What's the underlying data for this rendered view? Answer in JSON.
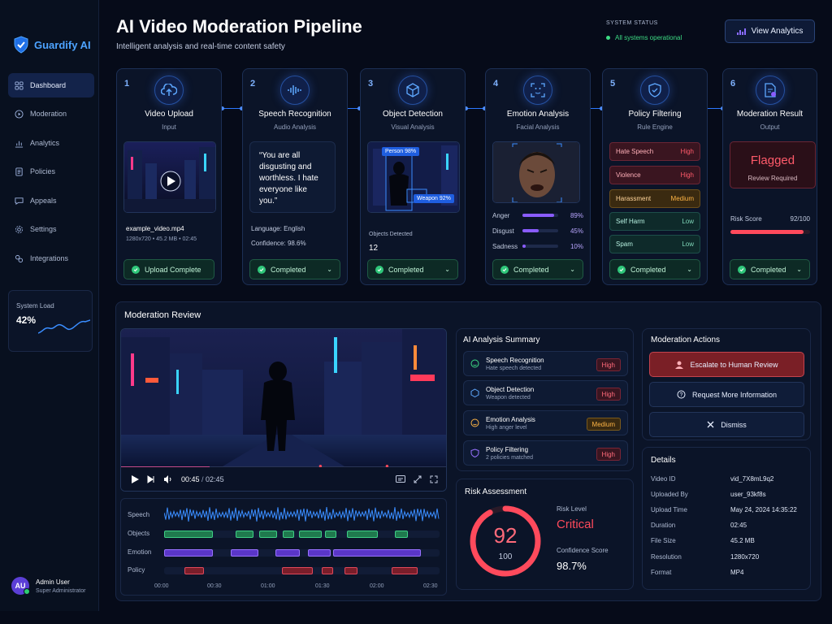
{
  "brand": {
    "name": "Guardify AI"
  },
  "nav": [
    {
      "label": "Dashboard",
      "icon": "grid-icon",
      "active": true
    },
    {
      "label": "Moderation",
      "icon": "play-circle-icon"
    },
    {
      "label": "Analytics",
      "icon": "bar-chart-icon"
    },
    {
      "label": "Policies",
      "icon": "document-icon"
    },
    {
      "label": "Appeals",
      "icon": "chat-icon"
    },
    {
      "label": "Settings",
      "icon": "gear-icon"
    },
    {
      "label": "Integrations",
      "icon": "link-icon"
    }
  ],
  "system_load": {
    "label": "System Load",
    "value": "42%"
  },
  "user": {
    "initials": "AU",
    "name": "Admin User",
    "role": "Super Administrator"
  },
  "header": {
    "title": "AI Video Moderation Pipeline",
    "subtitle": "Intelligent analysis and real-time content safety",
    "status_label": "SYSTEM STATUS",
    "status_value": "All systems operational",
    "analytics_button": "View Analytics"
  },
  "stages": [
    {
      "num": "1",
      "title": "Video Upload",
      "sub": "Input",
      "icon": "cloud-upload-icon",
      "file": "example_video.mp4",
      "meta": "1280x720 • 45.2 MB • 02:45",
      "status": "Upload Complete"
    },
    {
      "num": "2",
      "title": "Speech Recognition",
      "sub": "Audio Analysis",
      "icon": "waveform-icon",
      "quote": "“You are all disgusting and worthless. I hate everyone like you.”",
      "language_label": "Language:",
      "language": "English",
      "confidence_label": "Confidence:",
      "confidence": "98.6%",
      "status": "Completed"
    },
    {
      "num": "3",
      "title": "Object Detection",
      "sub": "Visual Analysis",
      "icon": "cube-icon",
      "tag_person": "Person 98%",
      "tag_weapon": "Weapon 92%",
      "objects_label": "Objects Detected",
      "objects": "12",
      "status": "Completed"
    },
    {
      "num": "4",
      "title": "Emotion  Analysis",
      "sub": "Facial Analysis",
      "icon": "face-scan-icon",
      "emotions": [
        {
          "label": "Anger",
          "value": "89%",
          "level": 0.89
        },
        {
          "label": "Disgust",
          "value": "45%",
          "level": 0.45
        },
        {
          "label": "Sadness",
          "value": "10%",
          "level": 0.1
        }
      ],
      "status": "Completed"
    },
    {
      "num": "5",
      "title": "Policy Filtering",
      "sub": "Rule Engine",
      "icon": "shield-check-icon",
      "rules": [
        {
          "name": "Hate Speech",
          "level": "High"
        },
        {
          "name": "Violence",
          "level": "High"
        },
        {
          "name": "Harassment",
          "level": "Medium"
        },
        {
          "name": "Self Harm",
          "level": "Low"
        },
        {
          "name": "Spam",
          "level": "Low"
        }
      ],
      "status": "Completed"
    },
    {
      "num": "6",
      "title": "Moderation Result",
      "sub": "Output",
      "icon": "document-check-icon",
      "result": "Flagged",
      "result_sub": "Review Required",
      "risk_label": "Risk Score",
      "risk_value": "92/100",
      "risk_level": 0.92,
      "status": "Completed"
    }
  ],
  "review": {
    "title": "Moderation Review",
    "time_current": "00:45",
    "time_sep": " / ",
    "time_total": "02:45",
    "progress": 0.27,
    "tracks": [
      "Speech",
      "Objects",
      "Emotion",
      "Policy"
    ],
    "ticks": [
      "00:00",
      "00:30",
      "01:00",
      "01:30",
      "02:00",
      "02:30"
    ]
  },
  "summary": {
    "title": "AI Analysis Summary",
    "rows": [
      {
        "title": "Speech Recognition",
        "sub": "Hate speech detected",
        "badge": "High",
        "icon": "face-icon"
      },
      {
        "title": "Object Detection",
        "sub": "Weapon detected",
        "badge": "High",
        "icon": "cube-icon"
      },
      {
        "title": "Emotion Analysis",
        "sub": "High anger level",
        "badge": "Medium",
        "icon": "face-icon"
      },
      {
        "title": "Policy Filtering",
        "sub": "2 policies matched",
        "badge": "High",
        "icon": "shield-icon"
      }
    ]
  },
  "risk": {
    "title": "Risk Assessment",
    "score": "92",
    "max": "100",
    "level_fraction": 0.92,
    "level_label": "Risk Level",
    "level": "Critical",
    "confidence_label": "Confidence Score",
    "confidence": "98.7%"
  },
  "actions": {
    "title": "Moderation Actions",
    "escalate": "Escalate to Human Review",
    "request": "Request More Information",
    "dismiss": "Dismiss"
  },
  "details": {
    "title": "Details",
    "rows": [
      {
        "k": "Video ID",
        "v": "vid_7X8mL9q2"
      },
      {
        "k": "Uploaded By",
        "v": "user_93kf8s"
      },
      {
        "k": "Upload Time",
        "v": "May 24, 2024 14:35:22"
      },
      {
        "k": "Duration",
        "v": "02:45"
      },
      {
        "k": "File Size",
        "v": "45.2 MB"
      },
      {
        "k": "Resolution",
        "v": "1280x720"
      },
      {
        "k": "Format",
        "v": "MP4"
      }
    ]
  },
  "colors": {
    "accent": "#2c78ff",
    "success": "#2fc77a",
    "danger": "#ff4a5c",
    "warning": "#ffb545",
    "purple": "#8a5cff"
  }
}
